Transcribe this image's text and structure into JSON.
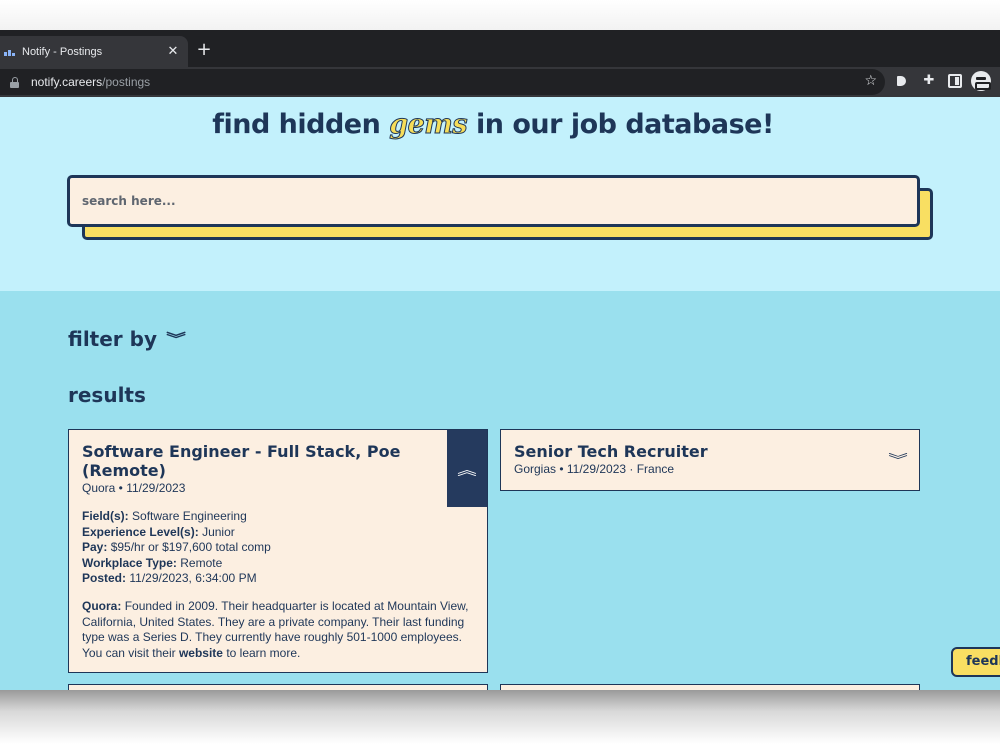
{
  "browser": {
    "tab_title": "Notify - Postings",
    "close_glyph": "✕",
    "new_tab_glyph": "+",
    "url_host": "notify.careers",
    "url_path": "/postings",
    "star_glyph": "☆",
    "icons": [
      "lock-icon",
      "bookmark-star-icon",
      "extension-tag-icon",
      "puzzle-icon",
      "side-panel-icon",
      "incognito-profile-icon"
    ]
  },
  "hero": {
    "headline_before": "find hidden ",
    "headline_gems": "gems",
    "headline_after": " in our job database!",
    "search_placeholder": "search here..."
  },
  "filter": {
    "label": "filter by",
    "chevron": "⌄"
  },
  "results": {
    "heading": "results",
    "cards": [
      {
        "title": "Software Engineer - Full Stack, Poe (Remote)",
        "company": "Quora",
        "date": "11/29/2023",
        "meta": "Quora • 11/29/2023",
        "expanded": true,
        "fields_label": "Field(s):",
        "fields_value": "Software Engineering",
        "experience_label": "Experience Level(s):",
        "experience_value": "Junior",
        "pay_label": "Pay:",
        "pay_value": "$95/hr or $197,600 total comp",
        "workplace_label": "Workplace Type:",
        "workplace_value": "Remote",
        "posted_label": "Posted:",
        "posted_value": "11/29/2023, 6:34:00 PM",
        "about_company": "Quora:",
        "about_text": "Founded in 2009. Their headquarter is located at Mountain View, California, United States. They are a private company. Their last funding type was a Series D. They currently have roughly 501-1000 employees. You can visit their",
        "about_link": "website",
        "about_tail": "to learn more."
      },
      {
        "title": "Senior Tech Recruiter",
        "meta": "Gorgias • 11/29/2023 · France",
        "expanded": false
      }
    ]
  },
  "feedback": {
    "label": "feedback"
  },
  "colors": {
    "navy": "#1e3658",
    "hero_bg": "#c3f1fc",
    "results_bg": "#9ae0ee",
    "card_bg": "#fcefe1",
    "accent_yellow": "#f9df62"
  }
}
